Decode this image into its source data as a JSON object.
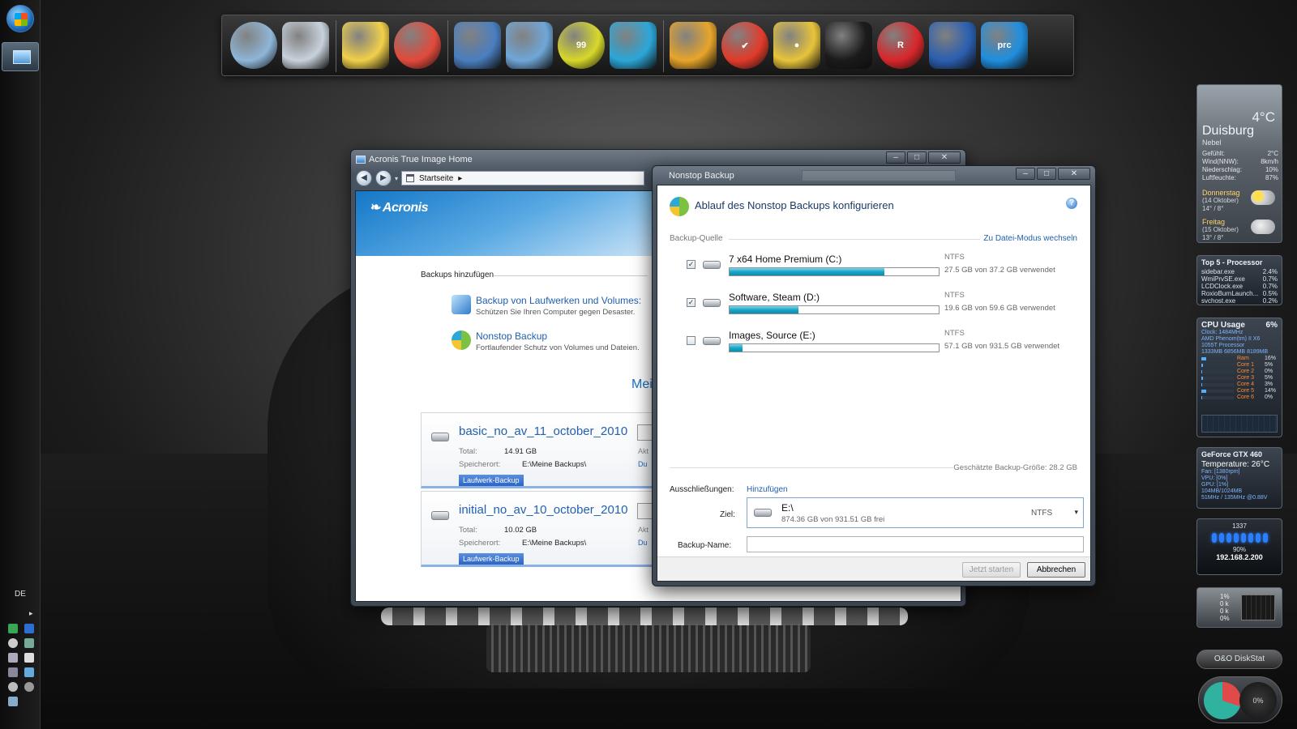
{
  "taskbar": {
    "language": "DE",
    "tray_arrow": "▸"
  },
  "dock": {
    "icons": [
      {
        "name": "home-icon",
        "label": "",
        "color": "#8fb6d8"
      },
      {
        "name": "trash-icon",
        "label": "",
        "color": "#c8d2dc"
      },
      {
        "name": "paint-icon",
        "label": "",
        "color": "#f2d04a"
      },
      {
        "name": "pinwheel-icon",
        "label": "",
        "color": "#e24a3b"
      },
      {
        "name": "network-icon",
        "label": "",
        "color": "#4a7fc0"
      },
      {
        "name": "computer-icon",
        "label": "",
        "color": "#6fa7d8"
      },
      {
        "name": "monitor-99-icon",
        "label": "99",
        "color": "#d8d82a"
      },
      {
        "name": "disc-refresh-icon",
        "label": "",
        "color": "#2ba7d8"
      },
      {
        "name": "ventrilo-icon",
        "label": "",
        "color": "#e8a52a"
      },
      {
        "name": "checkmark-icon",
        "label": "✔",
        "color": "#e23a2a"
      },
      {
        "name": "eye-player-icon",
        "label": "●",
        "color": "#e8c43a"
      },
      {
        "name": "face-icon",
        "label": "",
        "color": "#1a1a1a"
      },
      {
        "name": "r-icon",
        "label": "R",
        "color": "#d8262a"
      },
      {
        "name": "folder-icon",
        "label": "",
        "color": "#2a5fb0"
      },
      {
        "name": "prc-icon",
        "label": "prc",
        "color": "#1f8fe0"
      }
    ]
  },
  "gadgets": {
    "weather": {
      "temp": "4°C",
      "city": "Duisburg",
      "condition": "Nebel",
      "rows": [
        {
          "label": "Gefühlt:",
          "value": "2°C"
        },
        {
          "label": "Wind(NNW):",
          "value": "8km/h"
        },
        {
          "label": "Niederschlag:",
          "value": "10%"
        },
        {
          "label": "Luftfeuchte:",
          "value": "87%"
        }
      ],
      "days": [
        {
          "name": "Donnerstag",
          "date": "(14 Oktober)",
          "range": "14° / 8°"
        },
        {
          "name": "Freitag",
          "date": "(15 Oktober)",
          "range": "13° / 8°"
        }
      ]
    },
    "top5": {
      "title": "Top 5 - Processor",
      "rows": [
        {
          "name": "sidebar.exe",
          "value": "2.4%"
        },
        {
          "name": "WmiPrvSE.exe",
          "value": "0.7%"
        },
        {
          "name": "LCDClock.exe",
          "value": "0.7%"
        },
        {
          "name": "RoxioBurnLaunch...",
          "value": "0.5%"
        },
        {
          "name": "svchost.exe",
          "value": "0.2%"
        }
      ]
    },
    "cpu": {
      "title": "CPU Usage",
      "percent": "6%",
      "clock": "Clock: 1484MHz",
      "model": "AMD Phenom(tm) II X6 1055T Processor",
      "ram_used": "1333MB",
      "ram_free": "6856MB",
      "ram_total": "8189MB",
      "cores": [
        {
          "label": "Ram",
          "level": 0.16,
          "value": "16%"
        },
        {
          "label": "Core 1",
          "level": 0.05,
          "value": "5%"
        },
        {
          "label": "Core 2",
          "level": 0.0,
          "value": "0%"
        },
        {
          "label": "Core 3",
          "level": 0.05,
          "value": "5%"
        },
        {
          "label": "Core 4",
          "level": 0.03,
          "value": "3%"
        },
        {
          "label": "Core 5",
          "level": 0.14,
          "value": "14%"
        },
        {
          "label": "Core 6",
          "level": 0.0,
          "value": "0%"
        }
      ]
    },
    "gpu": {
      "title": "GeForce GTX 460",
      "temp_label": "Temperature:",
      "temp": "26°C",
      "lines": [
        "Fan: [1380rpm]",
        "VPU: [0%]",
        "GPU: [1%]",
        "104MB/1024MB",
        "51MHz / 135MHz @0.88V"
      ]
    },
    "net": {
      "count": "1337",
      "percent": "90%",
      "ip": "192.168.2.200"
    },
    "disk": {
      "lines": [
        "1%",
        "0 k",
        "0 k",
        "0%"
      ]
    },
    "ooo": {
      "label": "O&O DiskStat"
    },
    "gauge": {
      "value": "0%"
    }
  },
  "acronis": {
    "title": "Acronis True Image Home",
    "controls": {
      "min": "–",
      "max": "□",
      "close": "✕"
    },
    "nav": {
      "back": "◀",
      "forward": "▶",
      "dropdown": "▾",
      "breadcrumb": "Startseite",
      "breadcrumb_arrow": "▸"
    },
    "logo": "Acronis",
    "section_title": "Backups hinzufügen",
    "items": [
      {
        "title": "Backup von Laufwerken und Volumes:",
        "desc": "Schützen Sie Ihren Computer gegen Desaster."
      },
      {
        "title": "Nonstop Backup",
        "desc": "Fortlaufender Schutz von Volumes und Dateien."
      }
    ],
    "meine_label": "Mein",
    "backups": [
      {
        "name": "basic_no_av_11_october_2010",
        "total_label": "Total:",
        "total": "14.91 GB",
        "location_label": "Speicherort:",
        "location": "E:\\Meine Backups\\",
        "badge": "Laufwerk-Backup",
        "side1": "Akt",
        "side2": "Du"
      },
      {
        "name": "initial_no_av_10_october_2010",
        "total_label": "Total:",
        "total": "10.02 GB",
        "location_label": "Speicherort:",
        "location": "E:\\Meine Backups\\",
        "badge": "Laufwerk-Backup",
        "side1": "Akt",
        "side2": "Du"
      }
    ]
  },
  "nonstop": {
    "title": "Nonstop Backup",
    "controls": {
      "min": "–",
      "max": "□",
      "close": "✕"
    },
    "header": "Ablauf des Nonstop Backups konfigurieren",
    "help": "?",
    "source_label": "Backup-Quelle",
    "mode_link": "Zu Datei-Modus wechseln",
    "drives": [
      {
        "name": "7 x64 Home Premium (C:)",
        "checked": true,
        "used_fraction": 0.739,
        "fs": "NTFS",
        "usage": "27.5 GB von 37.2 GB verwendet"
      },
      {
        "name": "Software, Steam (D:)",
        "checked": true,
        "used_fraction": 0.329,
        "fs": "NTFS",
        "usage": "19.6 GB von 59.6 GB verwendet"
      },
      {
        "name": "Images, Source (E:)",
        "checked": false,
        "used_fraction": 0.061,
        "fs": "NTFS",
        "usage": "57.1 GB von 931.5 GB verwendet"
      }
    ],
    "estimate": "Geschätzte Backup-Größe: 28.2 GB",
    "exclusions_label": "Ausschließungen:",
    "exclusions_link": "Hinzufügen",
    "target_label": "Ziel:",
    "target": {
      "drive": "E:\\",
      "free": "874.36 GB von 931.51 GB frei",
      "fs": "NTFS",
      "caret": "▾"
    },
    "name_label": "Backup-Name:",
    "name_value": "",
    "start_button": "Jetzt starten",
    "cancel_button": "Abbrechen",
    "checkmark": "✓"
  }
}
